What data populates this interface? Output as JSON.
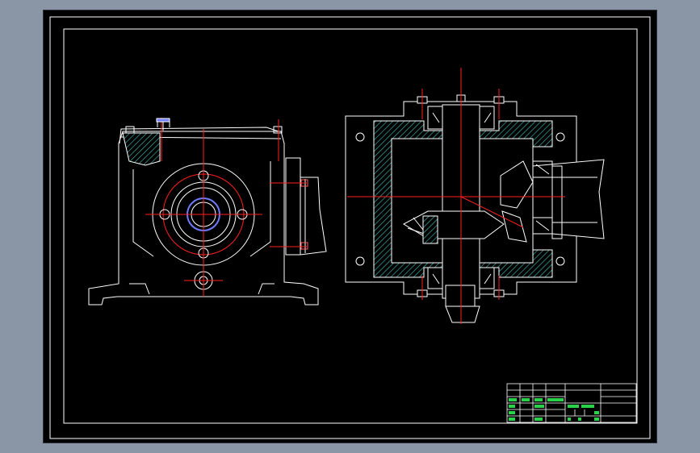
{
  "viewport": {
    "background_color": "#8a95a6",
    "sheet_color": "#000000"
  },
  "drawing": {
    "line_color": "#ffffff",
    "centerline_color": "#ff2020",
    "hatch_color": "#3fb6b0",
    "bolt_color": "#ff5a5a",
    "spline_color": "#6f7cff",
    "titleblock_text_color": "#2bd14a",
    "views": [
      "side-view",
      "top-section-view"
    ]
  },
  "title_block": {
    "illegible_cells": true
  }
}
